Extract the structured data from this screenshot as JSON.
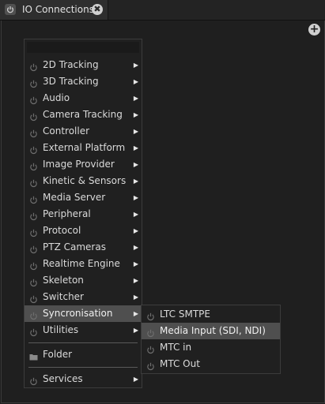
{
  "tab": {
    "title": "IO Connections",
    "icon": "power-icon",
    "close_glyph": "✖"
  },
  "add_glyph": "+",
  "menu": {
    "search_placeholder": "",
    "items": [
      {
        "label": "2D Tracking",
        "icon": "power-icon",
        "has_submenu": true
      },
      {
        "label": "3D Tracking",
        "icon": "power-icon",
        "has_submenu": true
      },
      {
        "label": "Audio",
        "icon": "power-icon",
        "has_submenu": true
      },
      {
        "label": "Camera Tracking",
        "icon": "power-icon",
        "has_submenu": true
      },
      {
        "label": "Controller",
        "icon": "power-icon",
        "has_submenu": true
      },
      {
        "label": "External Platform",
        "icon": "power-icon",
        "has_submenu": true
      },
      {
        "label": "Image Provider",
        "icon": "power-icon",
        "has_submenu": true
      },
      {
        "label": "Kinetic & Sensors",
        "icon": "power-icon",
        "has_submenu": true
      },
      {
        "label": "Media Server",
        "icon": "power-icon",
        "has_submenu": true
      },
      {
        "label": "Peripheral",
        "icon": "power-icon",
        "has_submenu": true
      },
      {
        "label": "Protocol",
        "icon": "power-icon",
        "has_submenu": true
      },
      {
        "label": "PTZ Cameras",
        "icon": "power-icon",
        "has_submenu": true
      },
      {
        "label": "Realtime Engine",
        "icon": "power-icon",
        "has_submenu": true
      },
      {
        "label": "Skeleton",
        "icon": "power-icon",
        "has_submenu": true
      },
      {
        "label": "Switcher",
        "icon": "power-icon",
        "has_submenu": true
      },
      {
        "label": "Syncronisation",
        "icon": "power-icon",
        "has_submenu": true,
        "active": true
      },
      {
        "label": "Utilities",
        "icon": "power-icon",
        "has_submenu": true
      }
    ],
    "folder": {
      "label": "Folder",
      "icon": "folder-icon"
    },
    "services": {
      "label": "Services",
      "icon": "power-icon",
      "has_submenu": true
    }
  },
  "submenu": {
    "items": [
      {
        "label": "LTC SMTPE",
        "icon": "power-icon"
      },
      {
        "label": "Media Input (SDI, NDI)",
        "icon": "power-icon",
        "hovered": true
      },
      {
        "label": "MTC in",
        "icon": "power-icon"
      },
      {
        "label": "MTC Out",
        "icon": "power-icon"
      }
    ]
  },
  "arrow_glyph": "▶",
  "colors": {
    "background": "#1e1e1e",
    "menu_bg": "#202020",
    "highlight": "#4f4f4f",
    "text": "#dadada"
  }
}
